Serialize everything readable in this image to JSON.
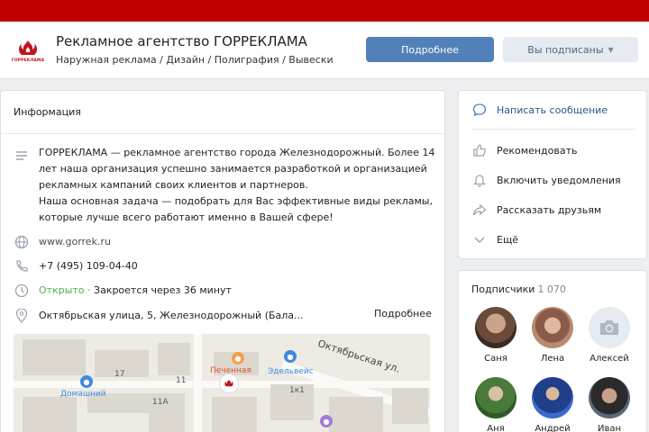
{
  "header": {
    "logo_text": "ГОРРЕКЛАМА",
    "title": "Рекламное агентство ГОРРЕКЛАМА",
    "subtitle": "Наружная реклама / Дизайн / Полиграфия / Вывески",
    "more_button": "Подробнее",
    "subscribed_button": "Вы подписаны"
  },
  "info": {
    "heading": "Информация",
    "description_lines": [
      "ГОРРЕКЛАМА — рекламное агентство города Железнодорожный. Более 14",
      "лет наша организация успешно занимается разработкой и организацией",
      "рекламных кампаний своих клиентов и партнеров.",
      "Наша основная задача — подобрать для Вас эффективные виды рекламы,",
      "которые лучше всего работают именно в Вашей сфере!"
    ],
    "website": "www.gorrek.ru",
    "phone": "+7 (495) 109-04-40",
    "status_open": "Открыто",
    "status_sep": "·",
    "status_closes": "Закроется через 36 минут",
    "address": "Октябрьская улица, 5, Железнодорожный (Бала...",
    "address_more": "Подробнее"
  },
  "map": {
    "street": "Октябрьская ул.",
    "house_17": "17",
    "house_11": "11",
    "house_11a": "11A",
    "house_1k1": "1к1",
    "poi_domashniy": "Домашний",
    "poi_pechennaya": "Печенная",
    "poi_edelveis": "Эдельвейс"
  },
  "actions": [
    {
      "label": "Написать сообщение",
      "icon": "message-icon"
    },
    {
      "label": "Рекомендовать",
      "icon": "thumbs-up-icon"
    },
    {
      "label": "Включить уведомления",
      "icon": "bell-icon"
    },
    {
      "label": "Рассказать друзьям",
      "icon": "share-icon"
    },
    {
      "label": "Ещё",
      "icon": "chevron-down-icon"
    }
  ],
  "subscribers": {
    "title": "Подписчики",
    "count": "1 070",
    "people": [
      {
        "name": "Саня"
      },
      {
        "name": "Лена"
      },
      {
        "name": "Алексей"
      },
      {
        "name": "Аня"
      },
      {
        "name": "Андрей"
      },
      {
        "name": "Иван"
      }
    ]
  },
  "colors": {
    "accent": "#5181b8",
    "brand_red": "#c00000",
    "open_green": "#4bb34b"
  }
}
